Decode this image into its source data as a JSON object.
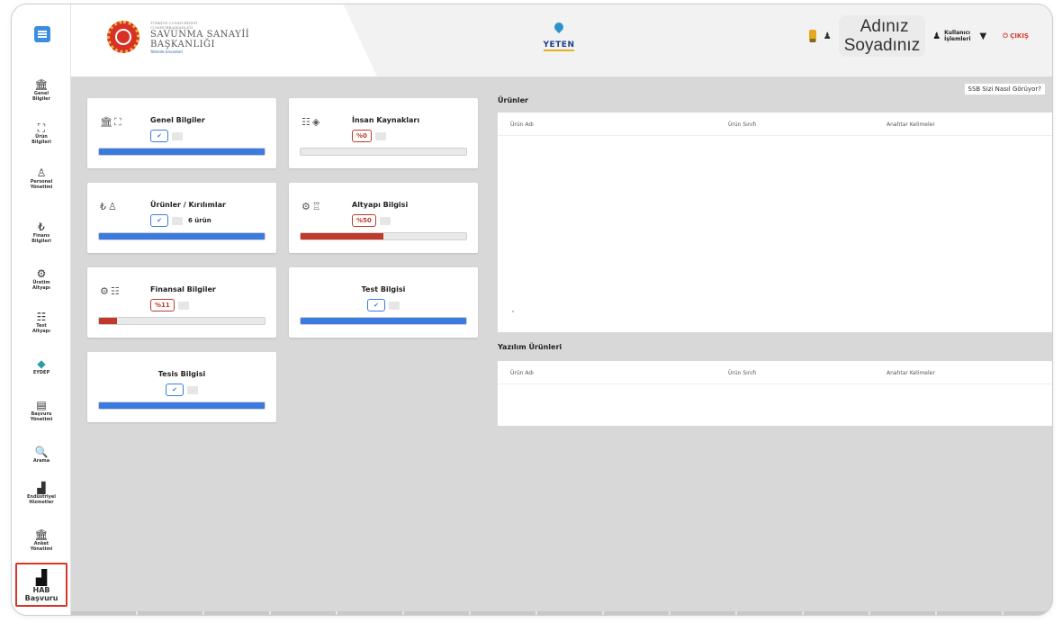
{
  "header": {
    "logo": {
      "small_line1": "TÜRKİYE CUMHURİYETİ",
      "small_line2": "CUMHURBAŞKANLIĞI",
      "title_line1": "SAVUNMA SANAYİİ",
      "title_line2": "BAŞKANLIĞI",
      "subtitle": "Yetenek Envanteri"
    },
    "center_logo_text": "YETEN",
    "user_name_line1": "Adınız",
    "user_name_line2": "Soyadınız",
    "user_ops_line1": "Kullanıcı",
    "user_ops_line2": "İşlemleri",
    "logout_label": "ÇIKIŞ"
  },
  "sidebar": {
    "items": [
      {
        "line1": "Genel",
        "line2": "Bilgiler",
        "icon": "building-icon",
        "glyph": "🏛"
      },
      {
        "line1": "Ürün",
        "line2": "Bilgileri",
        "icon": "box-icon",
        "glyph": "⛶"
      },
      {
        "line1": "Personel",
        "line2": "Yönetimi",
        "icon": "personnel-icon",
        "glyph": "♙"
      },
      {
        "line1": "Finans",
        "line2": "Bilgileri",
        "icon": "lira-icon",
        "glyph": "₺"
      },
      {
        "line1": "Üretim",
        "line2": "Altyapı",
        "icon": "gears-icon",
        "glyph": "⚙"
      },
      {
        "line1": "Test",
        "line2": "Altyapı",
        "icon": "list-icon",
        "glyph": "☷"
      },
      {
        "line1": "EYDEP",
        "line2": "",
        "icon": "cube-icon",
        "glyph": "◆"
      },
      {
        "line1": "Başvuru",
        "line2": "Yönetimi",
        "icon": "forms-icon",
        "glyph": "▤"
      },
      {
        "line1": "Arama",
        "line2": "",
        "icon": "search-icon",
        "glyph": "🔍"
      },
      {
        "line1": "Endüstriyel",
        "line2": "Hizmetler",
        "icon": "factory-icon",
        "glyph": "▟"
      },
      {
        "line1": "Anket",
        "line2": "Yönetimi",
        "icon": "survey-icon",
        "glyph": "🏛"
      },
      {
        "line1": "HAB",
        "line2": "Başvuru",
        "icon": "factory-icon",
        "glyph": "▟"
      }
    ]
  },
  "feedback_link": "SSB Sizi Nasıl Görüyor?",
  "cards": {
    "genel": {
      "title": "Genel Bilgiler",
      "icons": "🏛⛶",
      "status": "✔",
      "progress": 100,
      "color": "#3b7bdf"
    },
    "insan": {
      "title": "İnsan Kaynakları",
      "icons": "☷◈",
      "percent": "%0",
      "progress": 0,
      "color": "#c0392b"
    },
    "urunler": {
      "title": "Ürünler / Kırılımlar",
      "icons": "₺♙",
      "status": "✔",
      "count": "6 ürün",
      "progress": 100,
      "color": "#3b7bdf"
    },
    "altyapi": {
      "title": "Altyapı Bilgisi",
      "icons": "⚙♖",
      "percent": "%50",
      "progress": 50,
      "color": "#c0392b"
    },
    "finansal": {
      "title": "Finansal Bilgiler",
      "icons": "⚙☷",
      "percent": "%11",
      "progress": 11,
      "color": "#c0392b"
    },
    "test": {
      "title": "Test Bilgisi",
      "status": "✔",
      "progress": 100,
      "color": "#3b7bdf"
    },
    "tesis": {
      "title": "Tesis Bilgisi",
      "status": "✔",
      "progress": 100,
      "color": "#3b7bdf"
    }
  },
  "products": {
    "title": "Ürünler",
    "columns": [
      "Ürün Adı",
      "Ürün Sınıfı",
      "Anahtar Kelimeler"
    ],
    "rows": []
  },
  "software_products": {
    "title": "Yazılım Ürünleri",
    "columns": [
      "Ürün Adı",
      "Ürün Sınıfı",
      "Anahtar Kelimeler"
    ],
    "rows": []
  }
}
